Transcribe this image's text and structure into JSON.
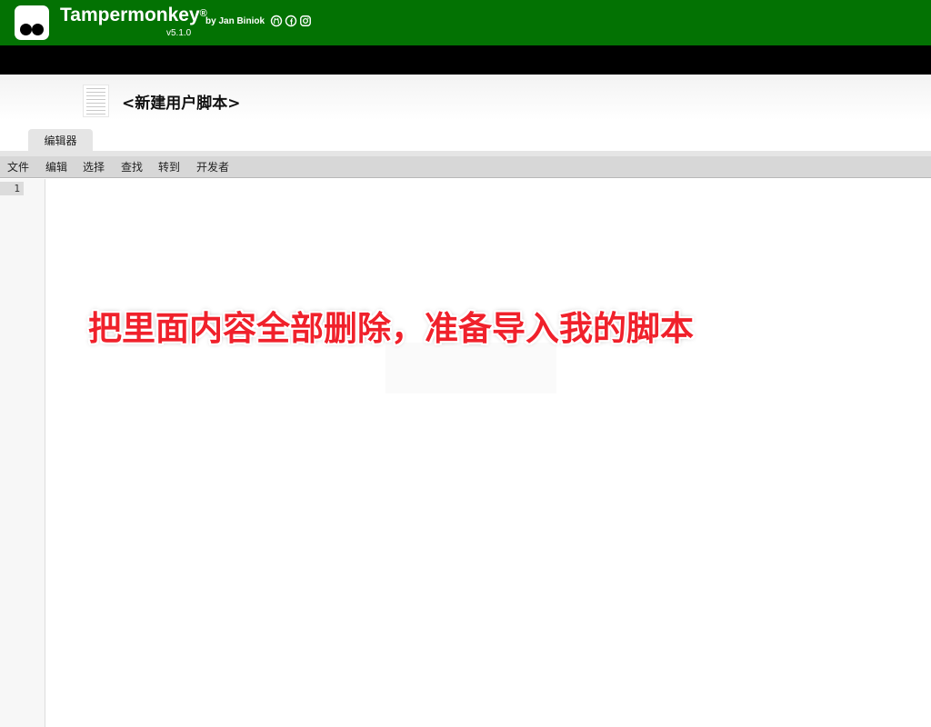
{
  "app": {
    "name": "Tampermonkey",
    "registered": "®",
    "version": "v5.1.0",
    "author": "by Jan Biniok"
  },
  "script": {
    "title": "<新建用户脚本>"
  },
  "tabs": [
    {
      "label": "编辑器"
    }
  ],
  "menu": [
    {
      "label": "文件"
    },
    {
      "label": "编辑"
    },
    {
      "label": "选择"
    },
    {
      "label": "查找"
    },
    {
      "label": "转到"
    },
    {
      "label": "开发者"
    }
  ],
  "editor": {
    "line_numbers": [
      "1"
    ]
  },
  "annotation": {
    "text": "把里面内容全部删除，准备导入我的脚本"
  },
  "colors": {
    "header_green": "#037203",
    "annotation_red": "#f0212b"
  },
  "icons": [
    "github-icon",
    "facebook-icon",
    "instagram-icon"
  ]
}
